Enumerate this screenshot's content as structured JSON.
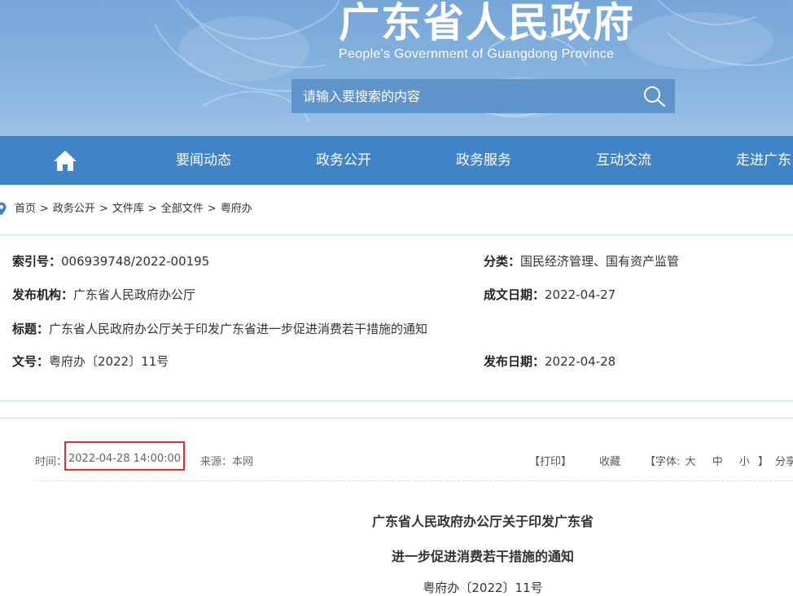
{
  "header": {
    "title": "广东省人民政府",
    "subtitle": "People's Government of Guangdong Province",
    "search_placeholder": "请输入要搜索的内容"
  },
  "nav": {
    "items": [
      "要闻动态",
      "政务公开",
      "政务服务",
      "互动交流",
      "走进广东"
    ]
  },
  "breadcrumb": [
    "首页",
    "政务公开",
    "文件库",
    "全部文件",
    "粤府办"
  ],
  "meta": {
    "index_label": "索引号：",
    "index_value": "006939748/2022-00195",
    "category_label": "分类：",
    "category_value": "国民经济管理、国有资产监管",
    "publisher_label": "发布机构：",
    "publisher_value": "广东省人民政府办公厅",
    "created_label": "成文日期：",
    "created_value": "2022-04-27",
    "title_label": "标题：",
    "title_value": "广东省人民政府办公厅关于印发广东省进一步促进消费若干措施的通知",
    "docno_label": "文号：",
    "docno_value": "粤府办〔2022〕11号",
    "published_label": "发布日期：",
    "published_value": "2022-04-28"
  },
  "article": {
    "time_label": "时间：",
    "time_value": "2022-04-28 14:00:00",
    "source": "来源：本网",
    "print": "【打印】",
    "favorite": "收藏",
    "font_prefix": "【字体:",
    "font_large": "大",
    "font_medium": "中",
    "font_small": "小",
    "font_suffix": "】",
    "share": "分享",
    "title_line1": "广东省人民政府办公厅关于印发广东省",
    "title_line2": "进一步促进消费若干措施的通知",
    "doc_number": "粤府办〔2022〕11号"
  },
  "colors": {
    "header_bg": "#86b3df",
    "nav_bg": "#3f84c7",
    "search_bg": "#5f93cc",
    "highlight_box": "#e03131",
    "divider": "#c8dced"
  }
}
